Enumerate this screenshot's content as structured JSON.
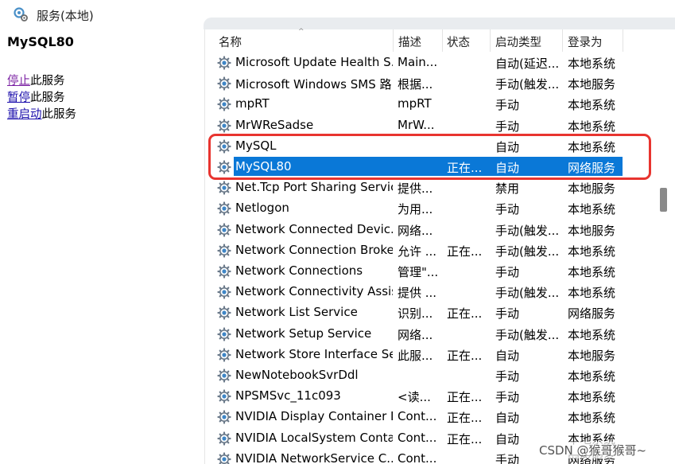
{
  "window": {
    "title": "服务(本地)",
    "icon": "services-gear-icon"
  },
  "left_panel": {
    "service_name": "MySQL80",
    "actions": [
      {
        "link": "停止",
        "rest": "此服务"
      },
      {
        "link": "暂停",
        "rest": "此服务"
      },
      {
        "link": "重启动",
        "rest": "此服务"
      }
    ]
  },
  "columns": {
    "name": "名称",
    "description": "描述",
    "status": "状态",
    "startup_type": "启动类型",
    "log_on_as": "登录为"
  },
  "rows": [
    {
      "name": "Microsoft Update Health S...",
      "desc": "Main...",
      "status": "",
      "start": "自动(延迟...",
      "logon": "本地系统"
    },
    {
      "name": "Microsoft Windows SMS 路...",
      "desc": "根据...",
      "status": "",
      "start": "手动(触发...",
      "logon": "本地服务"
    },
    {
      "name": "mpRT",
      "desc": "mpRT",
      "status": "",
      "start": "手动",
      "logon": "本地系统"
    },
    {
      "name": "MrWReSadse",
      "desc": "MrW...",
      "status": "",
      "start": "手动",
      "logon": "本地系统"
    },
    {
      "name": "MySQL",
      "desc": "",
      "status": "",
      "start": "自动",
      "logon": "本地系统"
    },
    {
      "name": "MySQL80",
      "desc": "",
      "status": "正在...",
      "start": "自动",
      "logon": "网络服务",
      "selected": true
    },
    {
      "name": "Net.Tcp Port Sharing Service",
      "desc": "提供...",
      "status": "",
      "start": "禁用",
      "logon": "本地服务"
    },
    {
      "name": "Netlogon",
      "desc": "为用...",
      "status": "",
      "start": "手动",
      "logon": "本地系统"
    },
    {
      "name": "Network Connected Devic...",
      "desc": "网络...",
      "status": "",
      "start": "手动(触发...",
      "logon": "本地服务"
    },
    {
      "name": "Network Connection Broker",
      "desc": "允许 ...",
      "status": "正在...",
      "start": "手动(触发...",
      "logon": "本地系统"
    },
    {
      "name": "Network Connections",
      "desc": "管理\"...",
      "status": "",
      "start": "手动",
      "logon": "本地系统"
    },
    {
      "name": "Network Connectivity Assis...",
      "desc": "提供 ...",
      "status": "",
      "start": "手动(触发...",
      "logon": "本地系统"
    },
    {
      "name": "Network List Service",
      "desc": "识别...",
      "status": "正在...",
      "start": "手动",
      "logon": "网络服务"
    },
    {
      "name": "Network Setup Service",
      "desc": "网络...",
      "status": "",
      "start": "手动(触发...",
      "logon": "本地系统"
    },
    {
      "name": "Network Store Interface Se...",
      "desc": "此服...",
      "status": "正在...",
      "start": "自动",
      "logon": "本地服务"
    },
    {
      "name": "NewNotebookSvrDdl",
      "desc": "",
      "status": "",
      "start": "手动",
      "logon": "本地系统"
    },
    {
      "name": "NPSMSvc_11c093",
      "desc": "<读...",
      "status": "正在...",
      "start": "手动",
      "logon": "本地系统"
    },
    {
      "name": "NVIDIA Display Container LS",
      "desc": "Cont...",
      "status": "正在...",
      "start": "自动",
      "logon": "本地系统"
    },
    {
      "name": "NVIDIA LocalSystem Conta...",
      "desc": "Cont...",
      "status": "正在...",
      "start": "自动",
      "logon": "本地系统"
    },
    {
      "name": "NVIDIA NetworkService C...",
      "desc": "Cont...",
      "status": "",
      "start": "手动",
      "logon": "网络服务"
    }
  ],
  "watermark": "CSDN @猴哥猴哥~",
  "colors": {
    "selection": "#0a78d7",
    "highlight_box": "#e8342f",
    "link": "#1a0dab",
    "link_visited": "#7a1fa2"
  }
}
